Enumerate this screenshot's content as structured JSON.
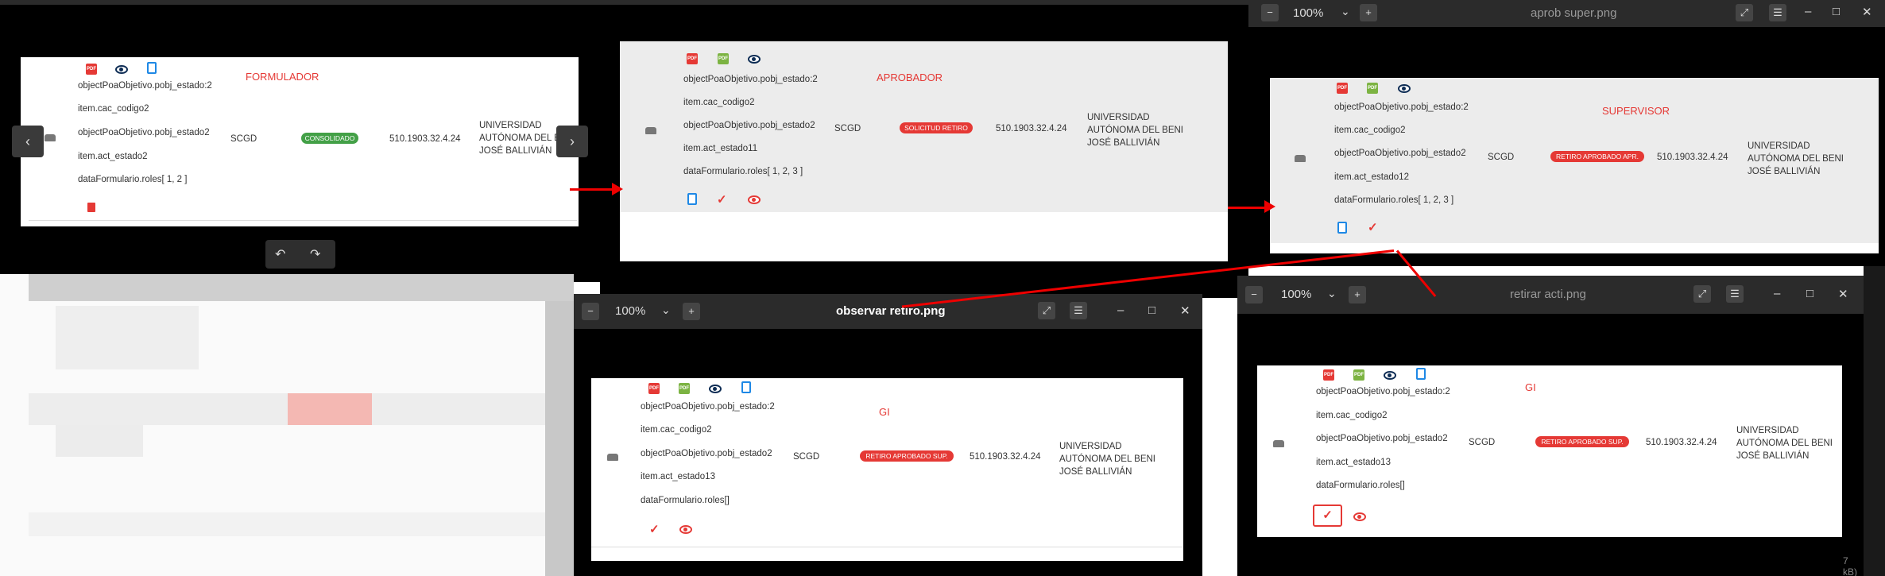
{
  "viewers": [
    {
      "title": "aprob super.png",
      "zoom": "100%"
    },
    {
      "title": "observar retiro.png",
      "zoom": "100%"
    },
    {
      "title": "retirar acti.png",
      "zoom": "100%"
    }
  ],
  "field_lines": {
    "estado_obj": "objectPoaObjetivo.pobj_estado:2",
    "cac": "item.cac_codigo2",
    "estado_obj2": "objectPoaObjetivo.pobj_estado2",
    "roles_prefix": "dataFormulario.roles"
  },
  "row": {
    "area": "SCGD",
    "code": "510.1903.32.4.24",
    "univ_line1": "UNIVERSIDAD",
    "univ_line2": "AUTÓNOMA DEL BENI",
    "univ_line3": "JOSÉ BALLIVIÁN"
  },
  "cards": {
    "formulador": {
      "role": "FORMULADOR",
      "act_estado": "item.act_estado2",
      "roles": "dataFormulario.roles[ 1, 2 ]",
      "badge": "CONSOLIDADO",
      "badge_color": "#43a047"
    },
    "aprobador": {
      "role": "APROBADOR",
      "act_estado": "item.act_estado11",
      "roles": "dataFormulario.roles[ 1, 2, 3 ]",
      "badge": "SOLICITUD RETIRO",
      "badge_color": "#e53935"
    },
    "supervisor": {
      "role": "SUPERVISOR",
      "act_estado": "item.act_estado12",
      "roles": "dataFormulario.roles[ 1, 2, 3 ]",
      "badge": "RETIRO APROBADO APR.",
      "badge_color": "#e53935"
    },
    "observar": {
      "role": "GI",
      "act_estado": "item.act_estado13",
      "roles": "dataFormulario.roles[]",
      "badge": "RETIRO APROBADO SUP.",
      "badge_color": "#e53935"
    },
    "retirar": {
      "role": "GI",
      "act_estado": "item.act_estado13",
      "roles": "dataFormulario.roles[]",
      "badge": "RETIRO APROBADO SUP.",
      "badge_color": "#e53935"
    }
  },
  "icons": [
    "pdf-icon",
    "form-icon",
    "eye-icon",
    "clipboard-icon",
    "check-icon",
    "trash-icon",
    "car-icon"
  ],
  "file_size_fragment": "7 kB)"
}
